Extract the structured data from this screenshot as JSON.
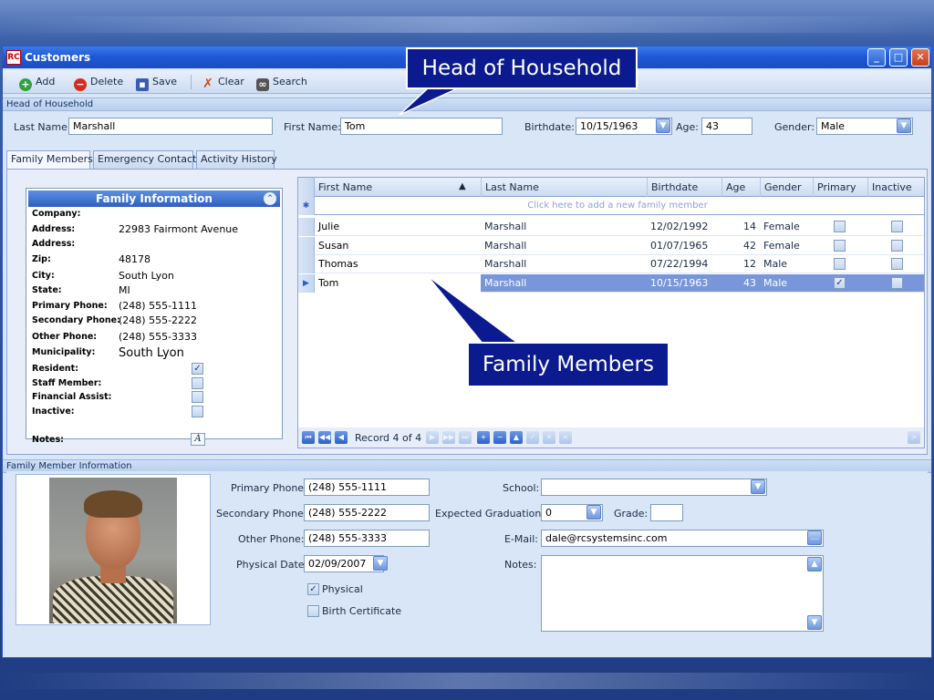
{
  "window": {
    "title": "Customers",
    "logo": "RC"
  },
  "toolbar": [
    {
      "label": "Add",
      "icon": "add-icon",
      "color": "#2fa341"
    },
    {
      "label": "Delete",
      "icon": "delete-icon",
      "color": "#d62a1e"
    },
    {
      "label": "Save",
      "icon": "save-icon",
      "color": "#3a5db0"
    },
    {
      "label": "Clear",
      "icon": "clear-icon",
      "color": "#d14a10"
    },
    {
      "label": "Search",
      "icon": "binoculars-icon",
      "color": "#444"
    }
  ],
  "head": {
    "section_title": "Head of Household",
    "last_name_label": "Last Name:",
    "last_name": "Marshall",
    "first_name_label": "First Name:",
    "first_name": "Tom",
    "birthdate_label": "Birthdate:",
    "birthdate": "10/15/1963",
    "age_label": "Age:",
    "age": "43",
    "gender_label": "Gender:",
    "gender": "Male"
  },
  "tabs": [
    {
      "label": "Family Members",
      "active": true
    },
    {
      "label": "Emergency Contacts",
      "active": false
    },
    {
      "label": "Activity History",
      "active": false
    }
  ],
  "family_info": {
    "title": "Family Information",
    "fields": [
      {
        "label": "Company:",
        "value": ""
      },
      {
        "label": "Address:",
        "value": "22983 Fairmont Avenue"
      },
      {
        "label": "Address:",
        "value": ""
      },
      {
        "label": "Zip:",
        "value": "48178"
      },
      {
        "label": "City:",
        "value": "South Lyon"
      },
      {
        "label": "State:",
        "value": "MI"
      },
      {
        "label": "Primary Phone:",
        "value": "(248) 555-1111"
      },
      {
        "label": "Secondary Phone:",
        "value": "(248) 555-2222"
      },
      {
        "label": "Other Phone:",
        "value": "(248) 555-3333"
      },
      {
        "label": "Municipality:",
        "value": "South Lyon"
      }
    ],
    "flags": [
      {
        "label": "Resident:",
        "checked": true
      },
      {
        "label": "Staff Member:",
        "checked": false
      },
      {
        "label": "Financial Assist:",
        "checked": false
      },
      {
        "label": "Inactive:",
        "checked": false
      }
    ],
    "notes_label": "Notes:"
  },
  "grid": {
    "columns": [
      "First Name",
      "Last Name",
      "Birthdate",
      "Age",
      "Gender",
      "Primary",
      "Inactive"
    ],
    "new_row_text": "Click here to add a new family member",
    "rows": [
      {
        "first": "Julie",
        "last": "Marshall",
        "birthdate": "12/02/1992",
        "age": "14",
        "gender": "Female",
        "primary": false,
        "inactive": false
      },
      {
        "first": "Susan",
        "last": "Marshall",
        "birthdate": "01/07/1965",
        "age": "42",
        "gender": "Female",
        "primary": false,
        "inactive": false
      },
      {
        "first": "Thomas",
        "last": "Marshall",
        "birthdate": "07/22/1994",
        "age": "12",
        "gender": "Male",
        "primary": false,
        "inactive": false
      },
      {
        "first": "Tom",
        "last": "Marshall",
        "birthdate": "10/15/1963",
        "age": "43",
        "gender": "Male",
        "primary": true,
        "inactive": false
      }
    ],
    "selected_row": 3,
    "record_text": "Record 4 of 4"
  },
  "member": {
    "section_title": "Family Member Information",
    "primary_phone_label": "Primary Phone:",
    "primary_phone": "(248) 555-1111",
    "secondary_phone_label": "Secondary Phone:",
    "secondary_phone": "(248) 555-2222",
    "other_phone_label": "Other Phone:",
    "other_phone": "(248) 555-3333",
    "physical_date_label": "Physical Date:",
    "physical_date": "02/09/2007",
    "physical_label": "Physical",
    "physical_checked": true,
    "birth_cert_label": "Birth Certificate",
    "birth_cert_checked": false,
    "school_label": "School:",
    "school": "",
    "grad_label": "Expected Graduation:",
    "grad": "0",
    "grade_label": "Grade:",
    "grade": "",
    "email_label": "E-Mail:",
    "email": "dale@rcsystemsinc.com",
    "notes_label": "Notes:"
  },
  "callouts": {
    "head": "Head of Household",
    "family": "Family Members"
  }
}
